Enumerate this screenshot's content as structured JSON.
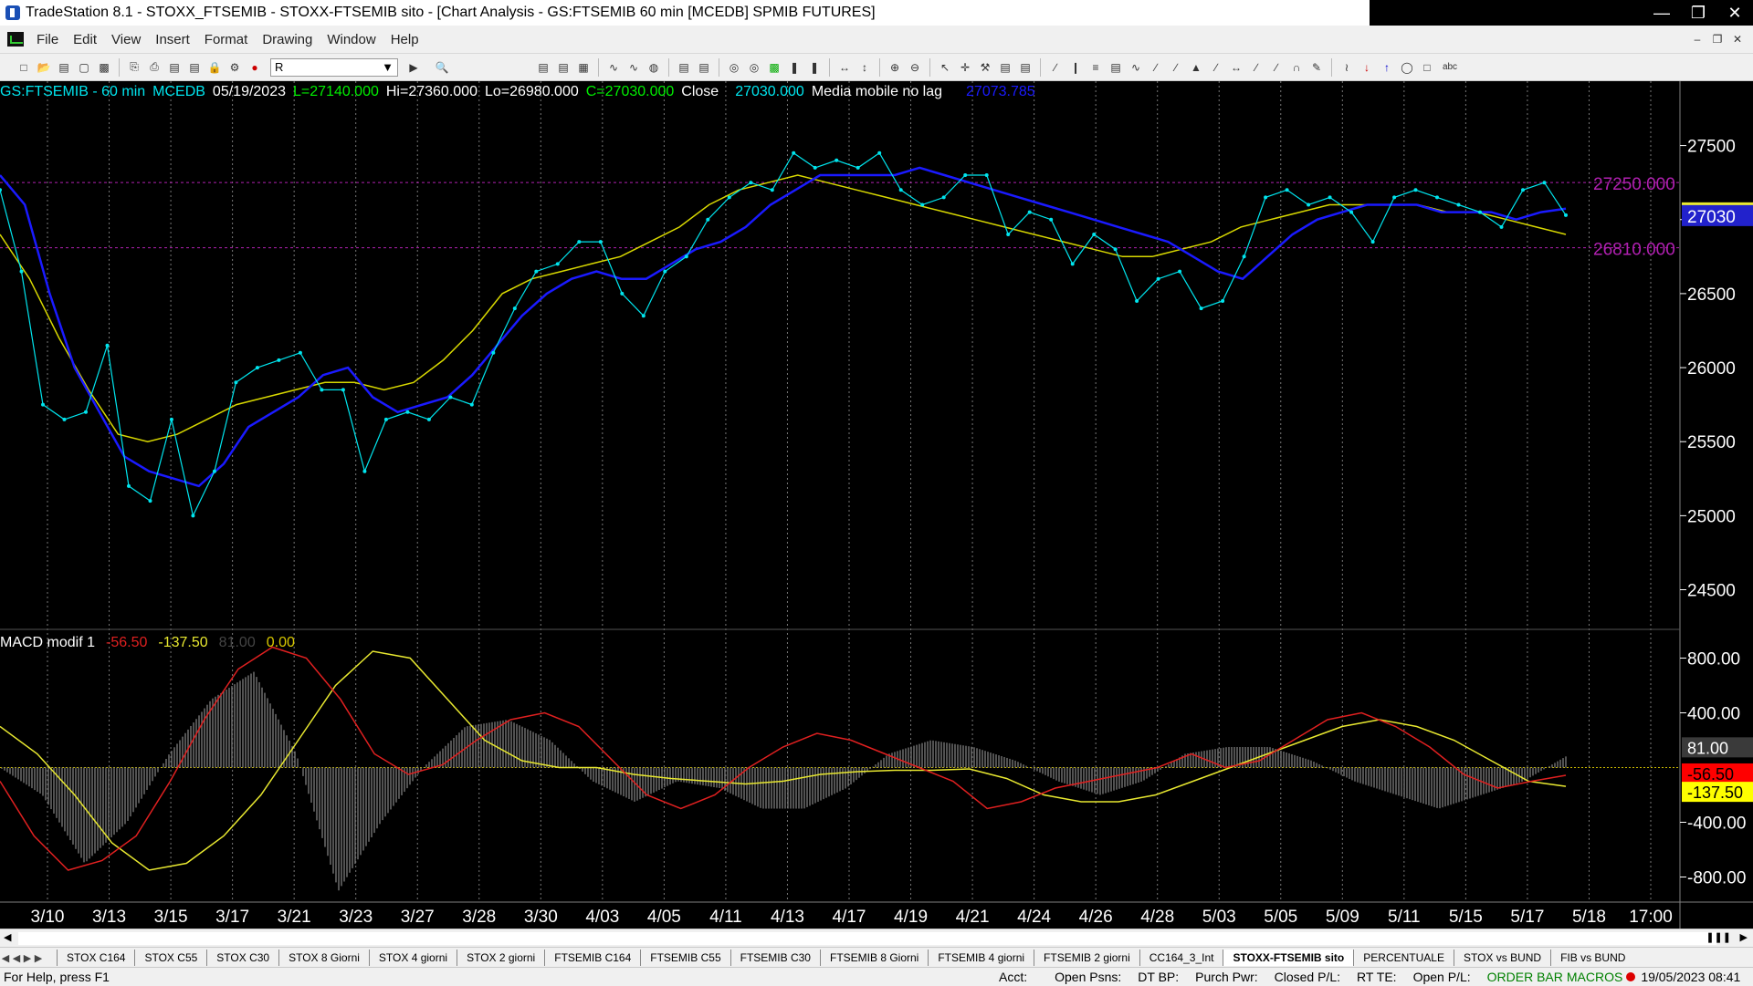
{
  "window": {
    "title": "TradeStation 8.1 - STOXX_FTSEMIB - STOXX-FTSEMIB sito - [Chart Analysis - GS:FTSEMIB  60 min  [MCEDB] SPMIB FUTURES]"
  },
  "menu": [
    "File",
    "Edit",
    "View",
    "Insert",
    "Format",
    "Drawing",
    "Window",
    "Help"
  ],
  "toolbar": {
    "combo_value": "R",
    "text_tool_label": "abc"
  },
  "status": {
    "symbol": "GS:FTSEMIB - 60 min",
    "exchange": "MCEDB",
    "date": "05/19/2023",
    "last": "L=27140.000",
    "high": "Hi=27360.000",
    "low": "Lo=26980.000",
    "close": "C=27030.000",
    "close_label": "Close",
    "close_value": "27030.000",
    "indicator_label": "Media mobile no lag",
    "indicator_value": "27073.785"
  },
  "macd": {
    "label": "MACD modif 1",
    "v1": "-56.50",
    "v2": "-137.50",
    "v3": "81.00",
    "v4": "0.00"
  },
  "colors": {
    "price": "#00e5ee",
    "ma_fast": "#1a1aff",
    "ma_slow": "#d8d800",
    "macd": "#e02020",
    "signal": "#e8e830",
    "level": "#b020b0"
  },
  "chart_data": [
    {
      "type": "line",
      "x_tick_labels": [
        "3/10",
        "3/13",
        "3/15",
        "3/17",
        "3/21",
        "3/23",
        "3/27",
        "3/28",
        "3/30",
        "4/03",
        "4/05",
        "4/11",
        "4/13",
        "4/17",
        "4/19",
        "4/21",
        "4/24",
        "4/26",
        "4/28",
        "5/03",
        "5/05",
        "5/09",
        "5/11",
        "5/15",
        "5/17",
        "5/18",
        "17:00"
      ],
      "y_ticks": [
        "27500",
        "27000",
        "26500",
        "26000",
        "25500",
        "25000",
        "24500"
      ],
      "ylim": [
        24300,
        27750
      ],
      "levels": [
        {
          "value": 27250,
          "label": "27250.000"
        },
        {
          "value": 26810,
          "label": "26810.000"
        }
      ],
      "last_price_label": "27030",
      "series": [
        {
          "values": [
            27200,
            26650,
            25750,
            25650,
            25700,
            26150,
            25200,
            25100,
            25650,
            25000,
            25300,
            25900,
            26000,
            26050,
            26100,
            25850,
            25850,
            25300,
            25650,
            25700,
            25650,
            25800,
            25750,
            26100,
            26400,
            26650,
            26700,
            26850,
            26850,
            26500,
            26350,
            26650,
            26750,
            27000,
            27150,
            27250,
            27200,
            27450,
            27350,
            27400,
            27350,
            27450,
            27200,
            27100,
            27150,
            27300,
            27300,
            26900,
            27050,
            27000,
            26700,
            26900,
            26800,
            26450,
            26600,
            26650,
            26400,
            26450,
            26750,
            27150,
            27200,
            27100,
            27150,
            27050,
            26850,
            27150,
            27200,
            27150,
            27100,
            27050,
            26950,
            27200,
            27250,
            27030
          ]
        },
        {
          "values": [
            27300,
            27100,
            26500,
            26000,
            25700,
            25400,
            25300,
            25250,
            25200,
            25350,
            25600,
            25700,
            25800,
            25950,
            26000,
            25800,
            25700,
            25750,
            25800,
            25950,
            26150,
            26350,
            26500,
            26600,
            26650,
            26600,
            26600,
            26700,
            26800,
            26850,
            26950,
            27100,
            27200,
            27300,
            27300,
            27300,
            27300,
            27350,
            27300,
            27250,
            27200,
            27150,
            27100,
            27050,
            27000,
            26950,
            26900,
            26850,
            26750,
            26650,
            26600,
            26750,
            26900,
            27000,
            27050,
            27100,
            27100,
            27100,
            27050,
            27050,
            27050,
            27000,
            27050,
            27073.785
          ]
        },
        {
          "values": [
            26900,
            26600,
            26200,
            25850,
            25550,
            25500,
            25550,
            25650,
            25750,
            25800,
            25850,
            25900,
            25900,
            25850,
            25900,
            26050,
            26250,
            26500,
            26600,
            26650,
            26700,
            26750,
            26850,
            26950,
            27100,
            27200,
            27250,
            27300,
            27250,
            27200,
            27150,
            27100,
            27050,
            27000,
            26950,
            26900,
            26850,
            26800,
            26750,
            26750,
            26800,
            26850,
            26950,
            27000,
            27050,
            27100,
            27100,
            27100,
            27100,
            27050,
            27050,
            27000,
            26950,
            26900
          ]
        }
      ]
    },
    {
      "type": "line",
      "y_ticks": [
        "800.00",
        "400.00",
        "-400.00",
        "-800.00"
      ],
      "ylim": [
        -950,
        950
      ],
      "tags": [
        "81.00",
        "-56.50",
        "-137.50"
      ],
      "series": [
        {
          "values": [
            -100,
            -500,
            -750,
            -680,
            -500,
            -100,
            350,
            720,
            880,
            800,
            500,
            100,
            -50,
            20,
            200,
            350,
            400,
            300,
            50,
            -200,
            -300,
            -200,
            0,
            150,
            250,
            200,
            100,
            0,
            -100,
            -300,
            -250,
            -150,
            -100,
            -50,
            0,
            100,
            0,
            50,
            200,
            350,
            400,
            300,
            150,
            -50,
            -150,
            -100,
            -56.5
          ]
        },
        {
          "values": [
            300,
            100,
            -200,
            -550,
            -750,
            -700,
            -500,
            -200,
            200,
            600,
            850,
            800,
            500,
            200,
            50,
            0,
            0,
            -50,
            -80,
            -100,
            -120,
            -100,
            -50,
            -30,
            -20,
            -20,
            -10,
            -80,
            -200,
            -250,
            -250,
            -200,
            -100,
            0,
            100,
            200,
            300,
            350,
            300,
            200,
            50,
            -100,
            -137.5
          ]
        },
        {
          "values": [
            0,
            -200,
            -700,
            -400,
            100,
            500,
            700,
            100,
            -900,
            -400,
            0,
            300,
            350,
            200,
            -100,
            -250,
            -100,
            -150,
            -300,
            -300,
            -150,
            100,
            200,
            150,
            50,
            -100,
            -200,
            -100,
            100,
            150,
            150,
            50,
            -100,
            -200,
            -300,
            -200,
            -100,
            81
          ]
        }
      ]
    }
  ],
  "sheet_tabs": [
    "STOX C164",
    "STOX C55",
    "STOX  C30",
    "STOX  8 Giorni",
    "STOX 4 giorni",
    "STOX  2 giorni",
    "FTSEMIB C164",
    "FTSEMIB C55",
    "FTSEMIB C30",
    "FTSEMIB  8 Giorni",
    "FTSEMIB  4 giorni",
    "FTSEMIB  2 giorni",
    "CC164_3_Int",
    "STOXX-FTSEMIB sito",
    "PERCENTUALE",
    "STOX vs BUND",
    "FIB vs BUND"
  ],
  "active_tab": 13,
  "statusbar": {
    "help": "For Help, press F1",
    "acct": "Acct:",
    "open_psns": "Open Psns:",
    "dt_bp": "DT BP:",
    "purch_pwr": "Purch Pwr:",
    "closed_pl": "Closed P/L:",
    "rt_te": "RT TE:",
    "open_pl": "Open P/L:",
    "order_bar": "ORDER BAR",
    "macros": "MACROS",
    "datetime": "19/05/2023 08:41"
  }
}
